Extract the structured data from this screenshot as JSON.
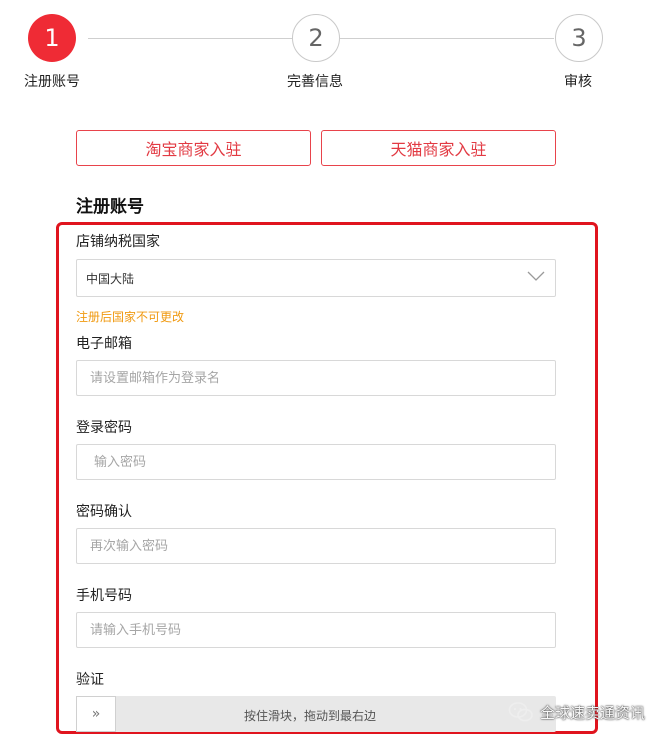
{
  "stepper": {
    "steps": [
      {
        "number": "1",
        "label": "注册账号",
        "active": true
      },
      {
        "number": "2",
        "label": "完善信息",
        "active": false
      },
      {
        "number": "3",
        "label": "审核",
        "active": false
      }
    ]
  },
  "store_types": {
    "taobao": "淘宝商家入驻",
    "tmall": "天猫商家入驻"
  },
  "form": {
    "title": "注册账号",
    "country": {
      "label": "店铺纳税国家",
      "value": "中国大陆",
      "hint": "注册后国家不可更改"
    },
    "email": {
      "label": "电子邮箱",
      "placeholder": "请设置邮箱作为登录名"
    },
    "password": {
      "label": "登录密码",
      "placeholder": "输入密码"
    },
    "confirm": {
      "label": "密码确认",
      "placeholder": "再次输入密码"
    },
    "phone": {
      "label": "手机号码",
      "placeholder": "请输入手机号码"
    },
    "verify": {
      "label": "验证",
      "handle": "»",
      "text": "按住滑块，拖动到最右边"
    }
  },
  "watermark": "全球速卖通资讯",
  "colors": {
    "accent": "#ef2b35",
    "hint": "#f09a12",
    "highlight": "#e0141e"
  }
}
